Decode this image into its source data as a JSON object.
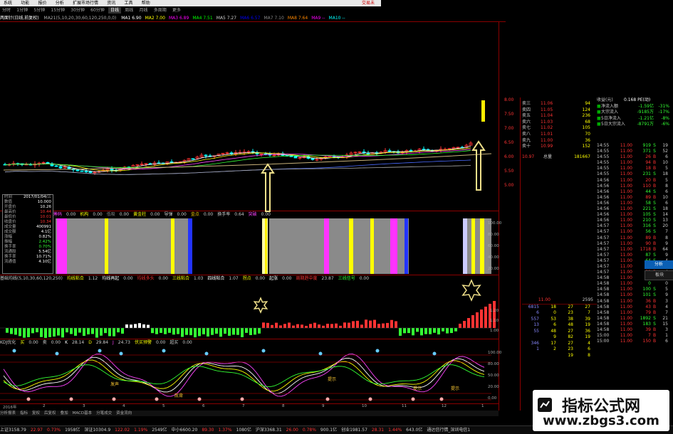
{
  "menubar": {
    "items": [
      "系统",
      "功能",
      "报价",
      "分析",
      "扩展市场行情",
      "资讯",
      "工具",
      "帮助"
    ],
    "right": "交易未"
  },
  "periods": {
    "items": [
      "分时",
      "1分钟",
      "5分钟",
      "15分钟",
      "30分钟",
      "60分钟",
      "日线",
      "周线",
      "月线",
      "多周期",
      "更多"
    ],
    "selected": "日线"
  },
  "ma_line": {
    "title": "两面针(日线,前复权)",
    "ma21": "MA21(5,10,20,30,60,120,250,0,0)",
    "values": [
      {
        "label": "MA1",
        "value": "6.90"
      },
      {
        "label": "MA2",
        "value": "7.00"
      },
      {
        "label": "MA3",
        "value": "6.89"
      },
      {
        "label": "MA4",
        "value": "7.51"
      },
      {
        "label": "MA5",
        "value": "7.27"
      },
      {
        "label": "MA6",
        "value": "6.57"
      },
      {
        "label": "MA7",
        "value": "7.10"
      },
      {
        "label": "MA8",
        "value": "7.64"
      },
      {
        "label": "MA9",
        "value": "--"
      },
      {
        "label": "MA10",
        "value": "--"
      }
    ]
  },
  "price_axis": [
    "8.00",
    "7.50",
    "7.00",
    "6.50",
    "6.00",
    "5.50",
    "5.00"
  ],
  "info_panel": {
    "rows": [
      [
        "时间",
        "2017/01/04/三"
      ],
      [
        "数值",
        "10.000"
      ],
      [
        "开盘价",
        "10.26"
      ],
      [
        "最高价",
        "10.44"
      ],
      [
        "最低价",
        "10.01"
      ],
      [
        "收盘价",
        "10.34"
      ],
      [
        "成交量",
        "400991"
      ],
      [
        "成交额",
        "4.1亿"
      ],
      [
        "涨幅",
        "0.82%"
      ],
      [
        "振幅",
        "2.42%"
      ],
      [
        "换手率",
        "0.70%"
      ],
      [
        "流通股",
        "5.54亿"
      ],
      [
        "换手率",
        "10.71%"
      ],
      [
        "流通值",
        "4.10亿"
      ]
    ]
  },
  "panel2": {
    "legend": [
      {
        "t": "筹码",
        "c": "#ff44ff"
      },
      {
        "t": "0.00",
        "c": "#ccc"
      },
      {
        "t": "机构",
        "c": "#ffff00"
      },
      {
        "t": "0.00",
        "c": "#ccc"
      },
      {
        "t": "低吸",
        "c": "#888"
      },
      {
        "t": "0.00",
        "c": "#ccc"
      },
      {
        "t": "黄金柱",
        "c": "#ffff00"
      },
      {
        "t": "0.00",
        "c": "#ccc"
      },
      {
        "t": "导弹",
        "c": "#ccc"
      },
      {
        "t": "0.00",
        "c": "#ccc"
      },
      {
        "t": "金点",
        "c": "#ffcc00"
      },
      {
        "t": "0.00",
        "c": "#ccc"
      },
      {
        "t": "换手率",
        "c": "#ccc"
      },
      {
        "t": "0.64",
        "c": "#ccc"
      },
      {
        "t": "突破",
        "c": "#ff44ff"
      },
      {
        "t": "0.00",
        "c": "#ccc"
      }
    ],
    "axis": [
      "100.00",
      "80.00",
      "60.00",
      "40.00",
      "20.00"
    ]
  },
  "panel3": {
    "legend": [
      {
        "t": "基础均线(5,10,30,60,120,250)",
        "c": "#ccc"
      },
      {
        "t": "均线粘合",
        "c": "#ffff00"
      },
      {
        "t": "1.12",
        "c": "#ccc"
      },
      {
        "t": "均线再起",
        "c": "#ffffff"
      },
      {
        "t": "0.00",
        "c": "#ccc"
      },
      {
        "t": "均线多头",
        "c": "#ff3333"
      },
      {
        "t": "0.00",
        "c": "#ccc"
      },
      {
        "t": "三线粘合",
        "c": "#ffff00"
      },
      {
        "t": "1.03",
        "c": "#ccc"
      },
      {
        "t": "四线粘合",
        "c": "#ffffff"
      },
      {
        "t": "1.07",
        "c": "#ccc"
      },
      {
        "t": "拐点",
        "c": "#ffff00"
      },
      {
        "t": "0.00",
        "c": "#ccc"
      },
      {
        "t": "起涨",
        "c": "#ffffff"
      },
      {
        "t": "0.00",
        "c": "#ccc"
      },
      {
        "t": "周期趋中度",
        "c": "#ff3333"
      },
      {
        "t": "23.87",
        "c": "#ccc"
      },
      {
        "t": "三线信号",
        "c": "#33ff33"
      },
      {
        "t": "0.00",
        "c": "#ccc"
      }
    ],
    "axis": [
      "1.20",
      "1.10",
      "1.00"
    ]
  },
  "panel4": {
    "legend": [
      {
        "t": "KDJ优化",
        "c": "#ccc"
      },
      {
        "t": "买",
        "c": "#ffff00"
      },
      {
        "t": "0.00",
        "c": "#ccc"
      },
      {
        "t": "卖",
        "c": "#ccc"
      },
      {
        "t": "0.00",
        "c": "#ccc"
      },
      {
        "t": "K",
        "c": "#ffffff"
      },
      {
        "t": "28.14",
        "c": "#ccc"
      },
      {
        "t": "D",
        "c": "#ffff00"
      },
      {
        "t": "29.84",
        "c": "#ccc"
      },
      {
        "t": "J",
        "c": "#ff44ff"
      },
      {
        "t": "24.73",
        "c": "#ccc"
      },
      {
        "t": "伏买预警",
        "c": "#ffff00"
      },
      {
        "t": "0.00",
        "c": "#ccc"
      },
      {
        "t": "超买",
        "c": "#ccc"
      },
      {
        "t": "0.00",
        "c": "#ccc"
      }
    ],
    "axis": [
      "100.00",
      "80.00",
      "50.00",
      "20.00",
      "0.00"
    ],
    "labels": [
      "发声",
      "底背",
      "提示",
      "提示",
      "提示"
    ]
  },
  "date_axis": [
    "2016年",
    "2",
    "3",
    "4",
    "5",
    "6",
    "7",
    "8",
    "9",
    "10",
    "11",
    "12",
    "1"
  ],
  "footer": {
    "items": [
      "分析报表",
      "指标",
      "复权",
      "后复权",
      "叠加",
      "MACD基本",
      "分笔成交",
      "资金流向"
    ]
  },
  "quote_top": {
    "rows": [
      [
        "三",
        "11.06",
        "94"
      ],
      [
        "四",
        "11.05",
        "124"
      ],
      [
        "五",
        "11.04",
        "236"
      ],
      [
        "六",
        "11.03",
        "68"
      ],
      [
        "七",
        "11.02",
        "105"
      ],
      [
        "八",
        "11.01",
        "70"
      ],
      [
        "九",
        "11.00",
        "36"
      ],
      [
        "十",
        "10.99",
        "152"
      ]
    ],
    "lower": [
      [
        "10.97",
        "总量",
        "181667"
      ]
    ]
  },
  "fund_flow": {
    "title": "收益(元)",
    "pe_label": "0.168 PE(动)",
    "rows": [
      [
        "净流入额",
        "-1.59亿",
        "-31%"
      ],
      [
        "大宗流入",
        "-9185万",
        "-17%"
      ],
      [
        "5日净流入",
        "-1.21亿",
        "-8%"
      ],
      [
        "5日大宗流入",
        "-8791万",
        "-6%"
      ]
    ]
  },
  "tick_list": {
    "rows": [
      [
        "14:55",
        "11.00",
        "919",
        "S",
        "19"
      ],
      [
        "14:55",
        "11.00",
        "371",
        "S",
        "52"
      ],
      [
        "14:55",
        "11.00",
        "26",
        "B",
        "6"
      ],
      [
        "14:55",
        "11.00",
        "94",
        "B",
        "10"
      ],
      [
        "14:55",
        "11.00",
        "18",
        "B",
        "5"
      ],
      [
        "14:55",
        "11.00",
        "231",
        "S",
        "18"
      ],
      [
        "14:56",
        "11.00",
        "20",
        "B",
        "5"
      ],
      [
        "14:56",
        "11.00",
        "110",
        "B",
        "8"
      ],
      [
        "14:56",
        "11.00",
        "44",
        "S",
        "6"
      ],
      [
        "14:56",
        "11.00",
        "89",
        "B",
        "10"
      ],
      [
        "14:56",
        "11.00",
        "58",
        "S",
        "6"
      ],
      [
        "14:56",
        "11.00",
        "221",
        "S",
        "18"
      ],
      [
        "14:56",
        "11.00",
        "105",
        "S",
        "14"
      ],
      [
        "14:56",
        "11.00",
        "210",
        "S",
        "13"
      ],
      [
        "14:57",
        "11.00",
        "316",
        "S",
        "20"
      ],
      [
        "14:57",
        "11.00",
        "56",
        "S",
        "7"
      ],
      [
        "14:57",
        "11.00",
        "89",
        "B",
        "8"
      ],
      [
        "14:57",
        "11.00",
        "90",
        "B",
        "9"
      ],
      [
        "14:57",
        "11.00",
        "1718",
        "B",
        "64"
      ],
      [
        "14:57",
        "11.00",
        "87",
        "S",
        "9"
      ],
      [
        "14:57",
        "11.00",
        "64",
        "S",
        "4"
      ],
      [
        "14:57",
        "11.00",
        "61",
        "B",
        "5"
      ],
      [
        "14:57",
        "11.00",
        "32",
        "B",
        "4"
      ],
      [
        "14:58",
        "11.00",
        "8",
        "B",
        "3"
      ],
      [
        "14:58",
        "11.00",
        "0",
        "",
        "0"
      ],
      [
        "14:58",
        "11.00",
        "100",
        "S",
        "5"
      ],
      [
        "14:58",
        "11.00",
        "101",
        "S",
        "9"
      ],
      [
        "14:58",
        "11.00",
        "36",
        "B",
        "3"
      ],
      [
        "14:58",
        "11.00",
        "43",
        "B",
        "4"
      ],
      [
        "14:58",
        "11.00",
        "79",
        "B",
        "7"
      ],
      [
        "14:58",
        "11.00",
        "1892",
        "S",
        "21"
      ],
      [
        "14:58",
        "11.00",
        "183",
        "S",
        "15"
      ],
      [
        "14:58",
        "11.00",
        "39",
        "B",
        "3"
      ],
      [
        "15:00",
        "11.00",
        "7",
        "B",
        "1"
      ],
      [
        "15:00",
        "11.00",
        "150",
        "B",
        "6"
      ]
    ]
  },
  "depth": {
    "header": [
      "11.00",
      "",
      "2595"
    ],
    "rows": [
      [
        "6815",
        "18",
        "27",
        "27"
      ],
      [
        "6",
        "0",
        "23",
        "7"
      ],
      [
        "557",
        "53",
        "38",
        "39"
      ],
      [
        "13",
        "6",
        "48",
        "19"
      ],
      [
        "55",
        "48",
        "27",
        "36"
      ],
      [
        "",
        "9",
        "82",
        "19"
      ],
      [
        "346",
        "17",
        "27",
        "4"
      ],
      [
        "1",
        "2",
        "23",
        "6"
      ],
      [
        "",
        "",
        "19",
        "8"
      ]
    ]
  },
  "statusbar": {
    "items": [
      {
        "t": "上证3158.79",
        "c": "#ccc"
      },
      {
        "t": "22.97",
        "c": "#f33"
      },
      {
        "t": "0.73%",
        "c": "#f33"
      },
      {
        "t": "1958亿",
        "c": "#ccc"
      },
      {
        "t": "深证10304.9",
        "c": "#ccc"
      },
      {
        "t": "122.02",
        "c": "#f33"
      },
      {
        "t": "1.19%",
        "c": "#f33"
      },
      {
        "t": "2549亿",
        "c": "#ccc"
      },
      {
        "t": "中小6600.20",
        "c": "#ccc"
      },
      {
        "t": "89.30",
        "c": "#f33"
      },
      {
        "t": "1.37%",
        "c": "#f33"
      },
      {
        "t": "1080亿",
        "c": "#ccc"
      },
      {
        "t": "沪深3368.31",
        "c": "#ccc"
      },
      {
        "t": "26.00",
        "c": "#f33"
      },
      {
        "t": "0.78%",
        "c": "#f33"
      },
      {
        "t": "900.1亿",
        "c": "#ccc"
      },
      {
        "t": "创业1981.57",
        "c": "#ccc"
      },
      {
        "t": "28.31",
        "c": "#f33"
      },
      {
        "t": "1.44%",
        "c": "#f33"
      },
      {
        "t": "643.0亿",
        "c": "#ccc"
      },
      {
        "t": "通达信行情_深圳电信1",
        "c": "#ccc"
      }
    ]
  },
  "watermark": {
    "line1": "指标公式网",
    "line2": "www.zbgs3.com"
  },
  "side_buttons": [
    "分析",
    "板块"
  ]
}
